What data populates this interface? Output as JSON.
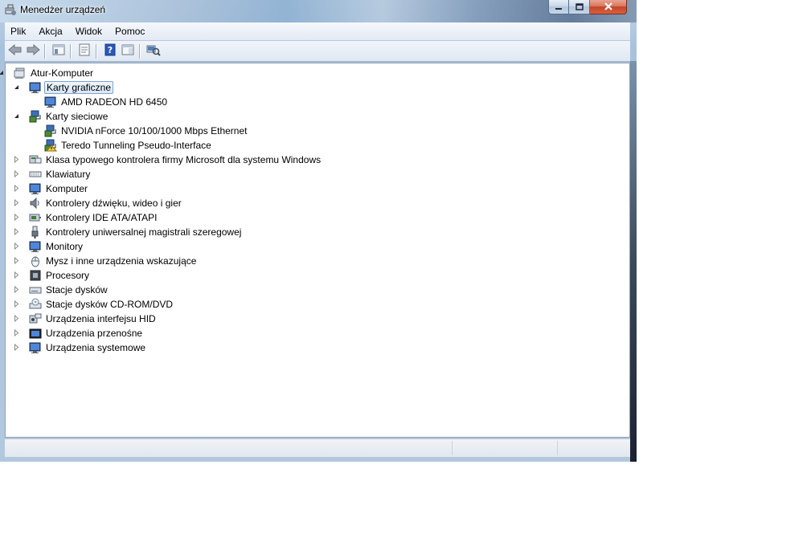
{
  "window": {
    "title": "Menedżer urządzeń",
    "title_icon": "device-manager-icon"
  },
  "caption": {
    "minimize_icon": "minimize-icon",
    "maximize_icon": "maximize-icon",
    "close_icon": "close-icon"
  },
  "menu": {
    "items": [
      "Plik",
      "Akcja",
      "Widok",
      "Pomoc"
    ]
  },
  "toolbar": {
    "buttons": [
      "back-arrow-icon",
      "forward-arrow-icon",
      "show-hide-console-tree-icon",
      "properties-icon",
      "help-icon",
      "action-pane-icon",
      "scan-hardware-icon"
    ]
  },
  "tree": {
    "root": "Atur-Komputer",
    "nodes": [
      {
        "label": "Karty graficzne",
        "level": 1,
        "expanded": true,
        "selected": true,
        "icon": "display-adapter-icon"
      },
      {
        "label": "AMD RADEON HD 6450",
        "level": 2,
        "icon": "display-adapter-icon"
      },
      {
        "label": "Karty sieciowe",
        "level": 1,
        "expanded": true,
        "icon": "network-adapter-icon"
      },
      {
        "label": "NVIDIA nForce 10/100/1000 Mbps Ethernet",
        "level": 2,
        "icon": "network-adapter-icon"
      },
      {
        "label": "Teredo Tunneling Pseudo-Interface",
        "level": 2,
        "icon": "network-adapter-warning-icon",
        "warning": true
      },
      {
        "label": "Klasa typowego kontrolera firmy Microsoft dla systemu Windows",
        "level": 1,
        "expanded": false,
        "icon": "usb-controller-class-icon"
      },
      {
        "label": "Klawiatury",
        "level": 1,
        "expanded": false,
        "icon": "keyboard-icon"
      },
      {
        "label": "Komputer",
        "level": 1,
        "expanded": false,
        "icon": "computer-icon"
      },
      {
        "label": "Kontrolery dźwięku, wideo i gier",
        "level": 1,
        "expanded": false,
        "icon": "speaker-icon"
      },
      {
        "label": "Kontrolery IDE ATA/ATAPI",
        "level": 1,
        "expanded": false,
        "icon": "ide-controller-icon"
      },
      {
        "label": "Kontrolery uniwersalnej magistrali szeregowej",
        "level": 1,
        "expanded": false,
        "icon": "usb-plug-icon"
      },
      {
        "label": "Monitory",
        "level": 1,
        "expanded": false,
        "icon": "monitor-icon"
      },
      {
        "label": "Mysz i inne urządzenia wskazujące",
        "level": 1,
        "expanded": false,
        "icon": "mouse-icon"
      },
      {
        "label": "Procesory",
        "level": 1,
        "expanded": false,
        "icon": "processor-icon"
      },
      {
        "label": "Stacje dysków",
        "level": 1,
        "expanded": false,
        "icon": "disk-drive-icon"
      },
      {
        "label": "Stacje dysków CD-ROM/DVD",
        "level": 1,
        "expanded": false,
        "icon": "dvd-drive-icon"
      },
      {
        "label": "Urządzenia interfejsu HID",
        "level": 1,
        "expanded": false,
        "icon": "hid-device-icon"
      },
      {
        "label": "Urządzenia przenośne",
        "level": 1,
        "expanded": false,
        "icon": "portable-device-icon"
      },
      {
        "label": "Urządzenia systemowe",
        "level": 1,
        "expanded": false,
        "icon": "system-devices-icon"
      }
    ]
  },
  "statusbar": {
    "panes": [
      "",
      "",
      ""
    ]
  },
  "colors": {
    "selection_border": "#7da2ce",
    "selection_fill": "#d9e8fb",
    "titlebar_glass": "#a7bfd8",
    "close_button": "#c7432a"
  }
}
